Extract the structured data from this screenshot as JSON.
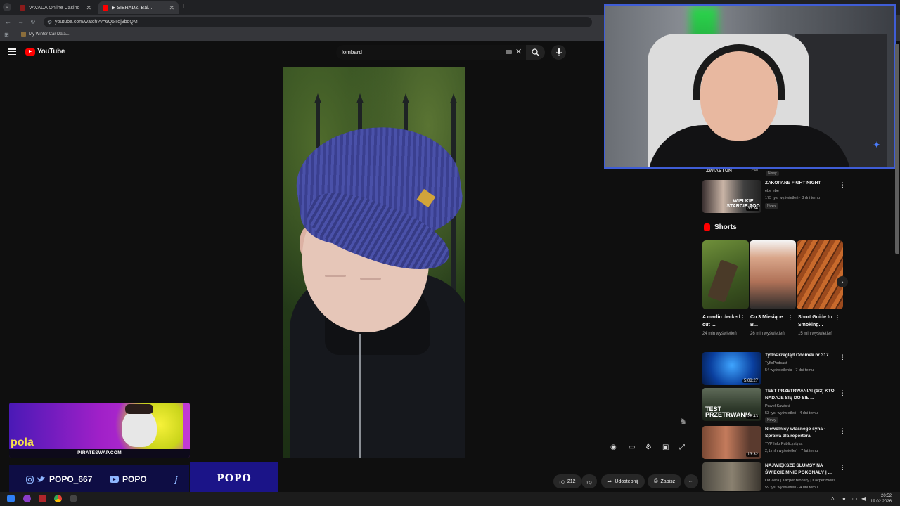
{
  "browser": {
    "tabs": [
      {
        "title": "VAVADA Online Casino",
        "favicon_color": "#8a1b1b",
        "active": false
      },
      {
        "title": "▶ SIERADZ: Bal...",
        "favicon_color": "#ff0000",
        "active": true
      }
    ],
    "url": "youtube.com/watch?v=6Q5Tdj9bdQM",
    "bookmark": "My Winter Car Data..."
  },
  "youtube": {
    "logo_text": "YouTube",
    "search_value": "lombard",
    "actions": {
      "likes": "212",
      "share": "Udostępnij",
      "save": "Zapisz",
      "more": "···"
    }
  },
  "webcam": {
    "label": "ZWIASTUN",
    "time": "2:40",
    "badge": "Nowy"
  },
  "sidebar": {
    "top_video": {
      "title": "ZAKOPANE FIGHT NIGHT",
      "channel": "ebe ebe",
      "meta": "175 tys. wyświetleń · 3 dni temu",
      "badge": "Nowy",
      "thumb_text": "WIELKIE STARCIE POD",
      "duration": "33:34"
    },
    "shorts_label": "Shorts",
    "shorts": [
      {
        "title": "A marlin decked out ...",
        "views": "24 mln wyświetleń"
      },
      {
        "title": "Co 3 Miesiące B...",
        "views": "26 mln wyświetleń"
      },
      {
        "title": "Short Guide to Smoking...",
        "views": "15 mln wyświetleń"
      }
    ],
    "videos": [
      {
        "title": "TyfloPrzegląd Odcinek nr 317",
        "channel": "TyfloPodcast",
        "meta": "54 wyświetlenia · 7 dni temu",
        "duration": "5:08:27",
        "badge": ""
      },
      {
        "title": "TEST PRZETRWANIA! (1/2) KTO NADAJE SIĘ DO SIŁ ...",
        "channel": "Paweł Sawicki",
        "meta": "53 tys. wyświetleń · 4 dni temu",
        "duration": "26:43",
        "badge": "Nowy",
        "thumb_text": "TEST PRZETRWANIA"
      },
      {
        "title": "Niewolnicy własnego syna - Sprawa dla reportera",
        "channel": "TVP Info Publicystyka",
        "meta": "2,1 mln wyświetleń · 7 lat temu",
        "duration": "13:32",
        "badge": ""
      },
      {
        "title": "NAJWIĘKSZE SLUMSY NA ŚWIECIE MNIE POKONAŁY | ...",
        "channel": "Od Zera | Kacper Blonsky | Kacper Blons...",
        "meta": "59 tys. wyświetleń · 4 dni temu",
        "duration": "",
        "badge": ""
      }
    ]
  },
  "overlay": {
    "ad_url": "PIRATESWAP.COM",
    "ad_text": "pola",
    "instagram_handle": "POPO_667",
    "youtube_handle": "POPO",
    "brand": "POPO"
  },
  "taskbar": {
    "time": "20:52",
    "date": "19.02.2026"
  },
  "colors": {
    "accent_red": "#ff0000",
    "overlay_blue": "#1b1488",
    "webcam_border": "#3f5dd6"
  }
}
